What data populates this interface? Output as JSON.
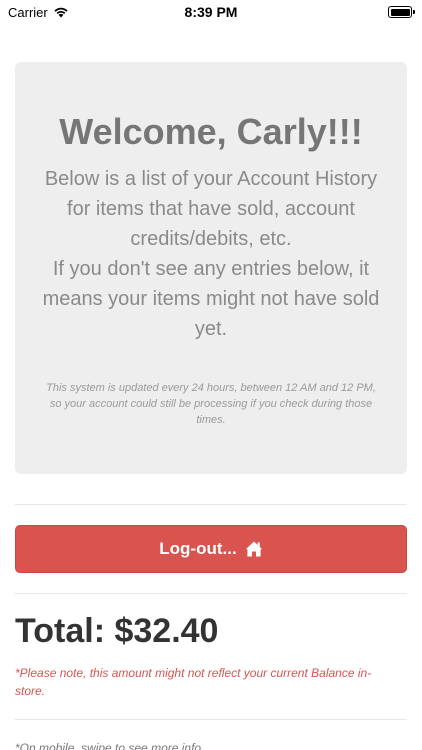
{
  "status_bar": {
    "carrier": "Carrier",
    "time": "8:39 PM"
  },
  "welcome": {
    "title": "Welcome, Carly!!!",
    "body_line1": "Below is a list of your Account History for items that have sold, account credits/debits, etc.",
    "body_line2": "If you don't see any entries below, it means your items might not have sold yet.",
    "note": "This system is updated every 24 hours, between 12 AM and 12 PM, so your account could still be processing if you check during those times."
  },
  "logout": {
    "label": "Log-out..."
  },
  "total": {
    "label": "Total: $32.40",
    "note": "*Please note, this amount might not reflect your current Balance in-store."
  },
  "footer": {
    "swipe_note": "*On mobile, swipe to see more info"
  },
  "colors": {
    "panel_bg": "#eeeeee",
    "danger": "#d9534f"
  }
}
